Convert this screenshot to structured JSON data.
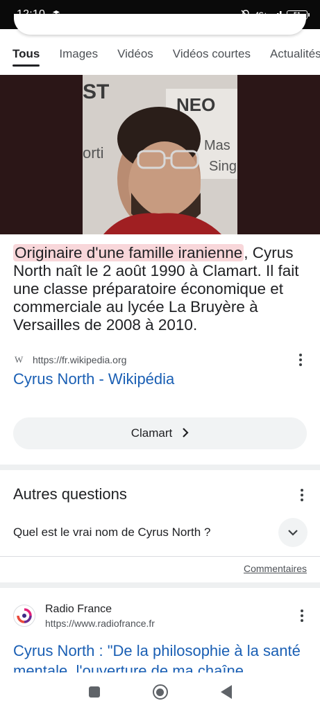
{
  "status_bar": {
    "time": "12:10",
    "network": "4G+",
    "battery": "51"
  },
  "tabs": [
    {
      "label": "Tous",
      "active": true
    },
    {
      "label": "Images",
      "active": false
    },
    {
      "label": "Vidéos",
      "active": false
    },
    {
      "label": "Vidéos courtes",
      "active": false
    },
    {
      "label": "Actualités",
      "active": false
    }
  ],
  "snippet": {
    "highlighted": "Originaire d'une famille iranienne",
    "rest": ", Cyrus North naît le 2 août 1990 à Clamart. Il fait une classe préparatoire économique et commerciale au lycée La Bruyère à Versailles de 2008 à 2010."
  },
  "featured_result": {
    "source_icon_letter": "W",
    "url": "https://fr.wikipedia.org",
    "title": "Cyrus North - Wikipédia"
  },
  "chip": {
    "label": "Clamart"
  },
  "related_questions": {
    "title": "Autres questions",
    "items": [
      {
        "question": "Quel est le vrai nom de Cyrus North ?"
      }
    ],
    "feedback_link": "Commentaires"
  },
  "result_2": {
    "site_name": "Radio France",
    "url": "https://www.radiofrance.fr",
    "title": "Cyrus North : \"De la philosophie à la santé mentale, l'ouverture de ma chaîne"
  },
  "colors": {
    "link": "#1a5fb4",
    "highlight": "#f8d7da",
    "chip_bg": "#f1f3f4"
  }
}
